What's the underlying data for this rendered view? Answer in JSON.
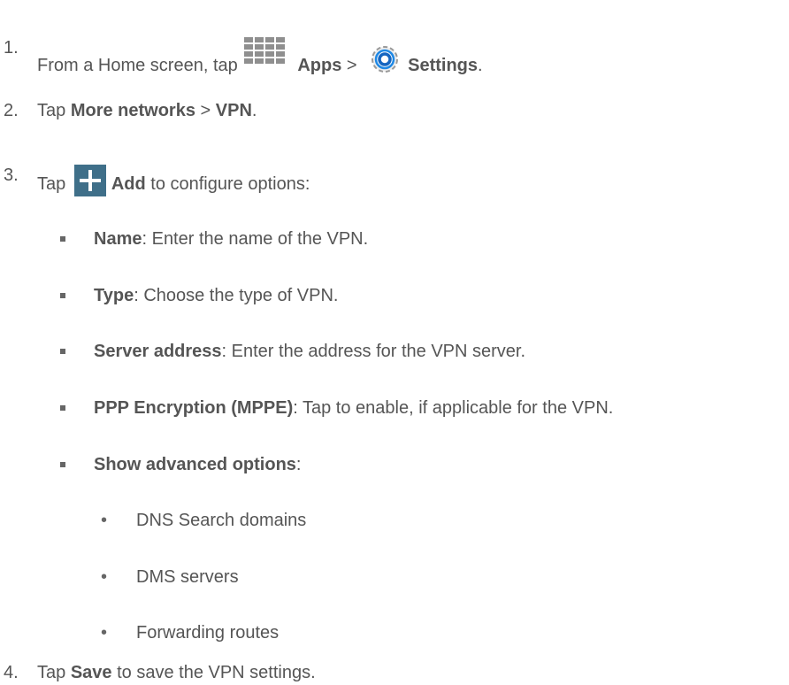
{
  "steps": [
    {
      "number": "1.",
      "prefix": "From a Home screen, tap",
      "apps_label": "Apps",
      "separator": ">",
      "settings_label": "Settings",
      "end": "."
    },
    {
      "number": "2.",
      "prefix": "Tap",
      "more_networks": "More networks",
      "separator": ">",
      "vpn": "VPN",
      "end": "."
    },
    {
      "number": "3.",
      "prefix": "Tap",
      "add_label": "Add",
      "suffix": "to configure options:"
    },
    {
      "number": "4.",
      "prefix": "Tap",
      "save_label": "Save",
      "suffix": "to save the VPN settings."
    }
  ],
  "options": [
    {
      "term": "Name",
      "desc": ": Enter the name of the VPN."
    },
    {
      "term": "Type",
      "desc": ": Choose the type of VPN."
    },
    {
      "term": "Server address",
      "desc": ": Enter the address for the VPN server."
    },
    {
      "term": "PPP Encryption (MPPE)",
      "desc": ": Tap to enable, if applicable for the VPN."
    },
    {
      "term": "Show advanced options",
      "desc": ":"
    }
  ],
  "advanced": [
    "DNS Search domains",
    "DMS servers",
    "Forwarding routes"
  ],
  "icons": {
    "apps": "apps-grid-icon",
    "settings": "settings-gear-icon",
    "add": "plus-add-icon"
  }
}
